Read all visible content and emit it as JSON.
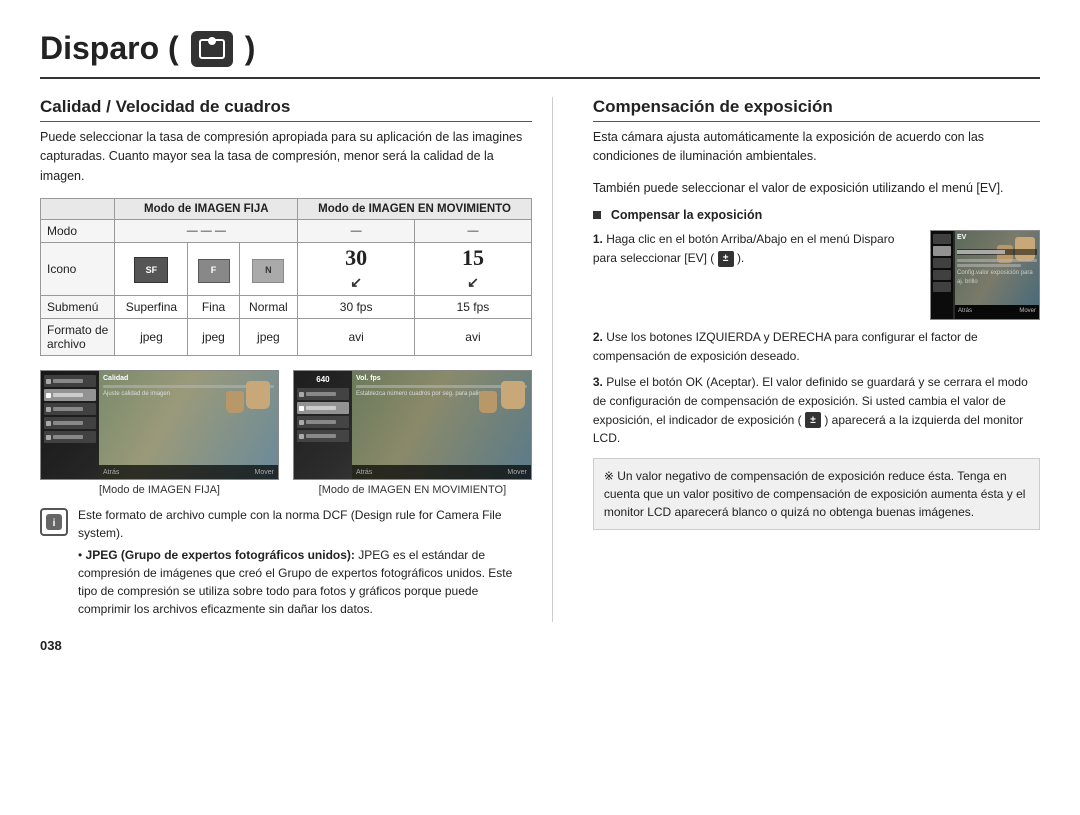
{
  "page": {
    "title": "Disparo (",
    "title_suffix": ")",
    "page_number": "038"
  },
  "left_section": {
    "title": "Calidad / Velocidad de cuadros",
    "intro": "Puede seleccionar la tasa de compresión apropiada para su aplicación de las imagines capturadas. Cuanto mayor sea la tasa de compresión, menor será la calidad de la imagen.",
    "table": {
      "headers": [
        "Modo",
        "Modo de IMAGEN FIJA",
        "",
        "",
        "Modo de IMAGEN EN MOVIMIENTO",
        ""
      ],
      "col_headers": [
        "Modo",
        "Modo de IMAGEN FIJA",
        "Modo de IMAGEN EN MOVIMIENTO"
      ],
      "row_modo_label": "Modo",
      "row_icono_label": "Icono",
      "row_submenu_label": "Submenú",
      "row_formato_label": "Formato de archivo",
      "col1_submenu": "Superfina",
      "col2_submenu": "Fina",
      "col3_submenu": "Normal",
      "col4_submenu": "30 fps",
      "col5_submenu": "15 fps",
      "col1_formato": "jpeg",
      "col2_formato": "jpeg",
      "col3_formato": "jpeg",
      "col4_formato": "avi",
      "col5_formato": "avi",
      "imagen_fija_header": "Modo de IMAGEN FIJA",
      "imagen_movimiento_header": "Modo de IMAGEN EN MOVIMIENTO"
    },
    "caption_left": "[Modo de IMAGEN FIJA]",
    "caption_right": "[Modo de IMAGEN EN MOVIMIENTO]",
    "note_line1": "Este formato de archivo cumple con la norma DCF (Design rule for Camera File system).",
    "note_bullet1": "JPEG (Grupo de expertos fotográficos unidos):",
    "note_bullet1_text": "JPEG es el estándar de compresión de imágenes que creó el Grupo de expertos fotográficos unidos. Este tipo de compresión se utiliza sobre todo para fotos y gráficos porque puede comprimir los archivos eficazmente sin dañar los datos."
  },
  "right_section": {
    "title": "Compensación de exposición",
    "intro1": "Esta cámara ajusta automáticamente la exposición de acuerdo con las condiciones de iluminación ambientales.",
    "intro2": "También puede seleccionar el valor de exposición utilizando el menú [EV].",
    "compensar_label": "Compensar la exposición",
    "step1_text": "Haga clic en el botón Arriba/Abajo en el menú Disparo para seleccionar [EV] (",
    "step1_symbol": "±",
    "step1_close": ").",
    "step2_text": "Use los botones IZQUIERDA y DERECHA para configurar el factor de compensación de exposición deseado.",
    "step3_text": "Pulse el botón OK (Aceptar). El valor definido se guardará y se cerrara el modo de configuración de compensación de exposición. Si usted cambia el valor de exposición, el indicador de exposición (",
    "step3_symbol": "±",
    "step3_close": ") aparecerá a la izquierda del monitor LCD.",
    "note_text": "※ Un valor negativo de compensación de exposición reduce ésta. Tenga en cuenta que un valor positivo de compensación de exposición aumenta ésta y el monitor LCD aparecerá blanco o quizá no obtenga buenas imágenes.",
    "ev_label": "EV",
    "ev_config_label": "Config.valor exposición para aj. brillo",
    "bottom_atras": "Atrás",
    "bottom_mover": "Mover"
  }
}
